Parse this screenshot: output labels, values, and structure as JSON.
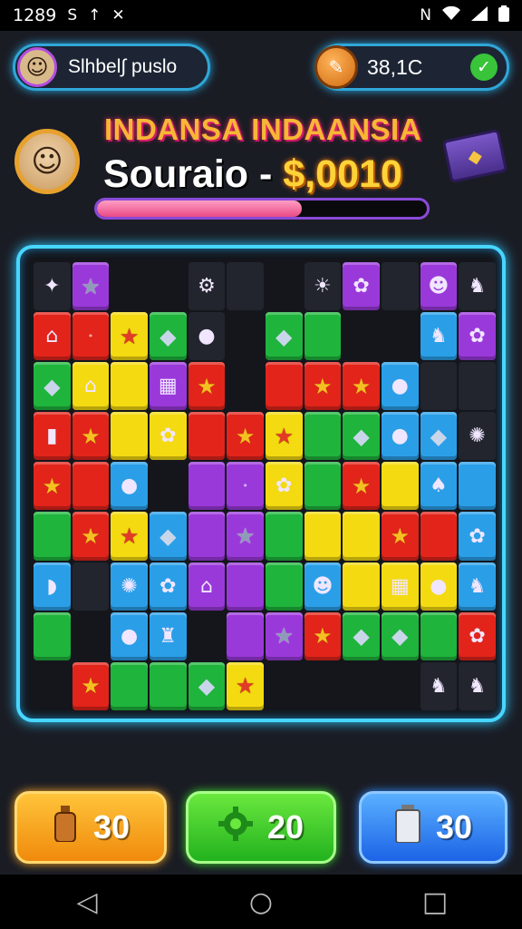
{
  "status": {
    "time": "1289",
    "left_icons": [
      "S",
      "↑",
      "✕"
    ],
    "right_icons": [
      "N",
      "wifi",
      "signal",
      "battery"
    ]
  },
  "topbar": {
    "player_name": "Slhbel∫ puslo",
    "coins": "38,1C"
  },
  "hero": {
    "banner": "INDANSA INDAANSIA",
    "score_prefix": "Souraio -",
    "score_value": "$,0010",
    "progress_percent": 62
  },
  "board": {
    "rows": [
      [
        "D:✦",
        "P:★",
        "E",
        "E",
        "D:⚙",
        "D",
        "E",
        "D:☀",
        "P:✿",
        "D",
        "P:☻",
        "D:♞"
      ],
      [
        "R:⌂",
        "R:•",
        "Y:★",
        "G:◆",
        "D:●",
        "E",
        "G:◆",
        "G",
        "E",
        "E",
        "B:♞",
        "P:✿"
      ],
      [
        "G:◆",
        "Y:⌂",
        "Y",
        "P:▦",
        "R:★",
        "E",
        "R",
        "R:★",
        "R:★",
        "B:●",
        "D",
        "D"
      ],
      [
        "R:▮",
        "R:★",
        "Y",
        "Y:✿",
        "R",
        "R:★",
        "Y:★",
        "G",
        "G:◆",
        "B:●",
        "B:◆",
        "D:✺"
      ],
      [
        "R:★",
        "R",
        "B:●",
        "E",
        "P",
        "P:•",
        "Y:✿",
        "G",
        "R:★",
        "Y",
        "B:♠",
        "B"
      ],
      [
        "G",
        "R:★",
        "Y:★",
        "B:◆",
        "P",
        "P:★",
        "G",
        "Y",
        "Y",
        "R:★",
        "R",
        "B:✿"
      ],
      [
        "B:◗",
        "D",
        "B:✺",
        "B:✿",
        "P:⌂",
        "P",
        "G",
        "B:☻",
        "Y",
        "Y:▦",
        "Y:●",
        "B:♞"
      ],
      [
        "G",
        "E",
        "B:●",
        "B:♜",
        "E",
        "P",
        "P:★",
        "R:★",
        "G:◆",
        "G:◆",
        "G",
        "R:✿"
      ],
      [
        "E",
        "R:★",
        "G",
        "G",
        "G:◆",
        "Y:★",
        "E",
        "E",
        "E",
        "E",
        "D:♞",
        "D:♞"
      ]
    ]
  },
  "boosters": [
    {
      "label": "30",
      "icon": "bottle-icon"
    },
    {
      "label": "20",
      "icon": "gear-icon"
    },
    {
      "label": "30",
      "icon": "canister-icon"
    }
  ],
  "colors": {
    "red": "#e2241b",
    "yellow": "#f4da10",
    "green": "#1fb43c",
    "blue": "#2a9fe8",
    "purple": "#9a39da",
    "board_glow": "#47d6ff"
  }
}
